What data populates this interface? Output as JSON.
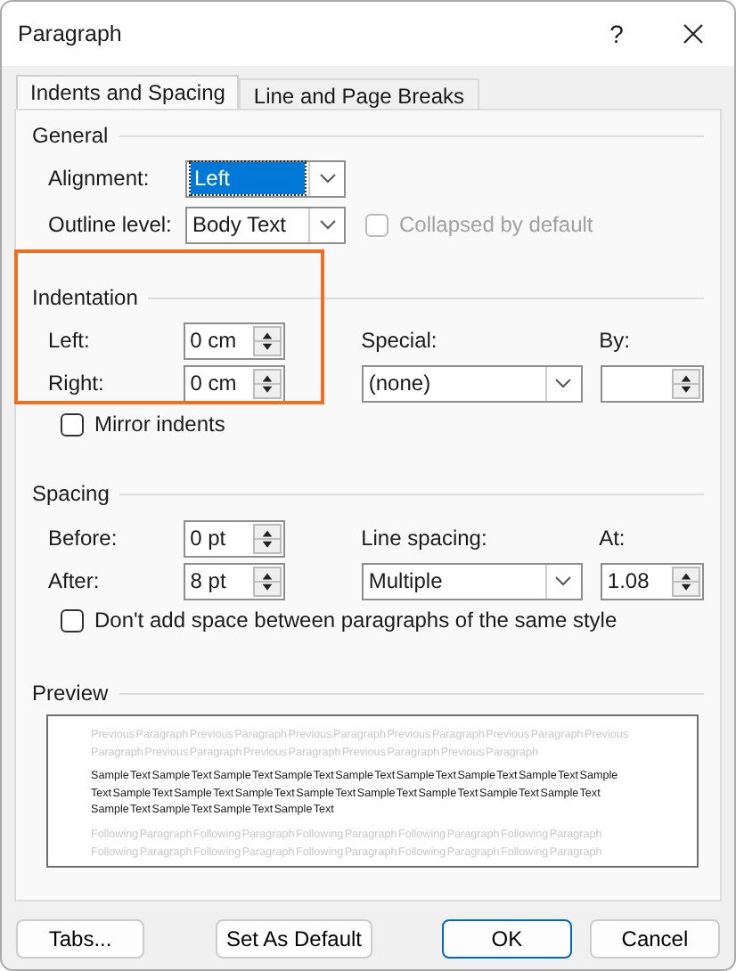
{
  "window": {
    "title": "Paragraph",
    "help": "?"
  },
  "tabs": [
    {
      "label": "Indents and Spacing",
      "selected": true
    },
    {
      "label": "Line and Page Breaks",
      "selected": false
    }
  ],
  "general": {
    "heading": "General",
    "alignment": {
      "label": "Alignment:",
      "value": "Left",
      "focused": true
    },
    "outline_level": {
      "label": "Outline level:",
      "value": "Body Text",
      "focused": false
    },
    "collapsed": {
      "label": "Collapsed by default",
      "checked": false,
      "disabled": true
    }
  },
  "indentation": {
    "heading": "Indentation",
    "highlighted": true,
    "left": {
      "label": "Left:",
      "value": "0 cm"
    },
    "right": {
      "label": "Right:",
      "value": "0 cm"
    },
    "special": {
      "label": "Special:",
      "value": "(none)"
    },
    "by": {
      "label": "By:"
    },
    "mirror": {
      "label": "Mirror indents",
      "checked": false,
      "disabled": false
    }
  },
  "spacing": {
    "heading": "Spacing",
    "before": {
      "label": "Before:",
      "value": "0 pt"
    },
    "after": {
      "label": "After:",
      "value": "8 pt"
    },
    "line_spacing": {
      "label": "Line spacing:",
      "value": "Multiple"
    },
    "at": {
      "label": "At:",
      "value": "1.08"
    },
    "dont_add": {
      "label": "Don't add space between paragraphs of the same style",
      "checked": false,
      "disabled": false
    }
  },
  "preview": {
    "heading": "Preview",
    "previous": "Previous Paragraph Previous Paragraph Previous Paragraph Previous Paragraph Previous Paragraph Previous Paragraph Previous Paragraph Previous Paragraph Previous Paragraph Previous Paragraph",
    "sample": "Sample Text Sample Text Sample Text Sample Text Sample Text Sample Text Sample Text Sample Text Sample Text Sample Text Sample Text Sample Text Sample Text Sample Text Sample Text Sample Text Sample Text Sample Text Sample Text Sample Text Sample Text",
    "following": "Following Paragraph Following Paragraph Following Paragraph Following Paragraph Following Paragraph Following Paragraph Following Paragraph Following Paragraph Following Paragraph Following Paragraph"
  },
  "buttons": [
    {
      "label": "Tabs...",
      "default": false
    },
    {
      "label": "Set As Default",
      "default": false
    },
    {
      "label": "OK",
      "default": true
    },
    {
      "label": "Cancel",
      "default": false
    }
  ]
}
